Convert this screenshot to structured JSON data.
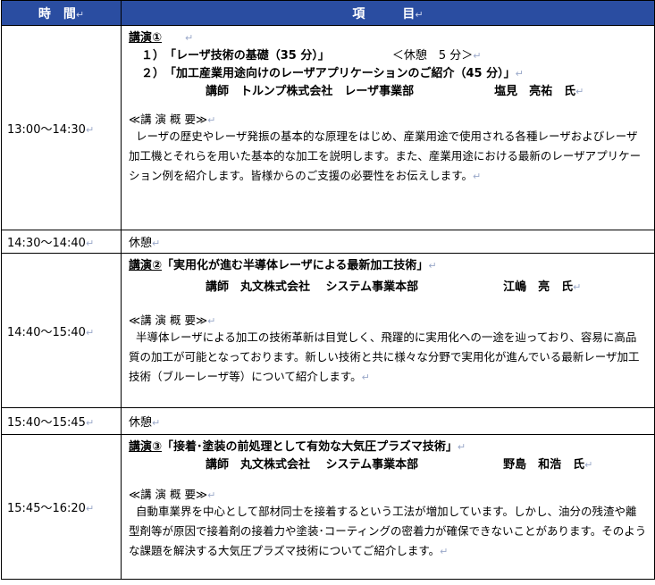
{
  "header": {
    "time": "時　間",
    "item": "項　　　目"
  },
  "rows": [
    {
      "time": "13:00～14:30",
      "lecture_label": "講演①",
      "talk1": "１）　「レーザ技術の基礎（35 分）」",
      "break": "＜休憩　5 分＞",
      "talk2": "２）　「加工産業用途向けのレーザアプリケーションのご紹介（45 分）」",
      "speaker_org": "講師　トルンプ株式会社　レーザ事業部",
      "speaker_name": "塩見　亮祐　氏",
      "summary_head": "≪講 演 概 要≫",
      "summary": "レーザの歴史やレーザ発振の基本的な原理をはじめ、産業用途で使用される各種レーザおよびレーザ加工機とそれらを用いた基本的な加工を説明します。また、産業用途における最新のレーザアプリケーション例を紹介します。皆様からのご支援の必要性をお伝えします。"
    },
    {
      "time": "14:30～14:40",
      "label": "休憩"
    },
    {
      "time": "14:40～15:40",
      "lecture_label": "講演②",
      "title": "「実用化が進む半導体レーザによる最新加工技術」",
      "speaker_org": "講師　丸文株式会社　 システム事業本部",
      "speaker_name": "江嶋　亮　氏",
      "summary_head": "≪講 演 概 要≫",
      "summary": "半導体レーザによる加工の技術革新は目覚しく、飛躍的に実用化への一途を辿っており、容易に高品質の加工が可能となっております。新しい技術と共に様々な分野で実用化が進んでいる最新レーザ加工技術（ブルーレーザ等）について紹介します。"
    },
    {
      "time": "15:40～15:45",
      "label": "休憩"
    },
    {
      "time": "15:45～16:20",
      "lecture_label": "講演③",
      "title": "「接着･塗装の前処理として有効な大気圧プラズマ技術」",
      "speaker_org": "講師　丸文株式会社　 システム事業本部",
      "speaker_name": "野島　和浩　氏",
      "summary_head": "≪講 演 概 要≫",
      "summary": "自動車業界を中心として部材同士を接着するという工法が増加しています。しかし、油分の残渣や離型剤等が原因で接着剤の接着力や塗装･コーティングの密着力が確保できないことがあります。そのような課題を解決する大気圧プラズマ技術についてご紹介します。"
    }
  ],
  "marks": {
    "return": "↵"
  },
  "colors": {
    "header_bg": "#2a4da1",
    "header_text": "#ffffff",
    "mark": "#9aa8c9"
  }
}
